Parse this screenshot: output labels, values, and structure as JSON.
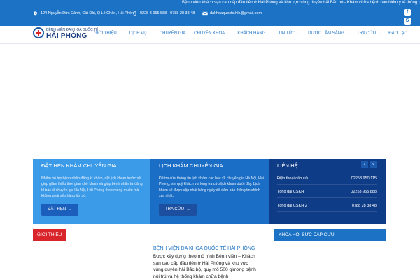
{
  "topbar": {
    "marquee": "Bệnh viện khách sạn cao cấp đầu tiên ở Hải Phòng và khu vực vùng duyên hải Bắc bộ - Khám chữa bệnh bảo hiểm y tế thông tuyến tất cả",
    "address": "124 Nguyễn Đức Cảnh, Cát Dài, Q Lê Chân, Hải Phòng",
    "phone": "0225 3 955 888 - 0788 28 38 48",
    "email": "dakhoaquocte.hih@gmail.com",
    "social": [
      "facebook",
      "skype"
    ]
  },
  "logo": {
    "top": "BỆNH VIỆN ĐA KHOA QUỐC TẾ",
    "main": "HẢI PHÒNG"
  },
  "menu": [
    {
      "label": "GIỚI THIỆU",
      "dropdown": true
    },
    {
      "label": "DỊCH VỤ",
      "dropdown": true
    },
    {
      "label": "CHUYÊN GIA",
      "dropdown": false
    },
    {
      "label": "CHUYÊN KHOA",
      "dropdown": true
    },
    {
      "label": "KHÁCH HÀNG",
      "dropdown": true
    },
    {
      "label": "TIN TỨC",
      "dropdown": true
    },
    {
      "label": "DƯỢC LÂM SÀNG",
      "dropdown": true
    },
    {
      "label": "TRA CỨU",
      "dropdown": true
    },
    {
      "label": "ĐÀO TẠO",
      "dropdown": false
    }
  ],
  "boxes": {
    "appointment": {
      "title": "ĐẶT HẸN KHÁM CHUYÊN GIA",
      "text": "Nhằm hỗ trợ bệnh nhân đăng kí khám, đặt lịch khám trước sẽ giúp giảm thiểu thời gian chờ khám và giúp bệnh nhân tự đăng kí bác sĩ chuyên gia Hà Nội, Hải Phòng theo mong muốn mà không phải xếp hàng lấy số.",
      "button": "ĐẶT HẸN"
    },
    "schedule": {
      "title": "LỊCH KHÁM CHUYÊN GIA",
      "text": "Để tra cứu thông tin lịch khám các bác sĩ, chuyên gia Hà Nội, Hải Phòng, xin quý khách vui lòng tra cứu lịch khám dưới đây. Lịch khám sẽ được cập nhật hàng ngày để đảm bảo thông tin chính xác nhất.",
      "button": "TRA CỨU"
    },
    "contact": {
      "title": "LIÊN HỆ",
      "rows": [
        {
          "label": "Điện thoại cấp cứu",
          "value": "02253 950 115"
        },
        {
          "label": "Tổng đài CSKH",
          "value": "02253 955 888"
        },
        {
          "label": "Tổng đài CSKH 2",
          "value": "0788 28 38 48"
        }
      ]
    }
  },
  "intro": {
    "tag": "GIỚI THIỆU",
    "title": "BỆNH VIỆN ĐA KHOA QUỐC TẾ HẢI PHÒNG",
    "text": "Được xây dựng theo mô hình Bệnh viện – Khách sạn cao cấp đầu tiên ở Hải Phòng và khu vực vùng duyên hải Bắc bộ, quy mô 500 giường bệnh nội trú và hệ thống khám chữa bệnh"
  },
  "emergency": {
    "title": "KHOA HỒI SỨC CẤP CỨU"
  }
}
